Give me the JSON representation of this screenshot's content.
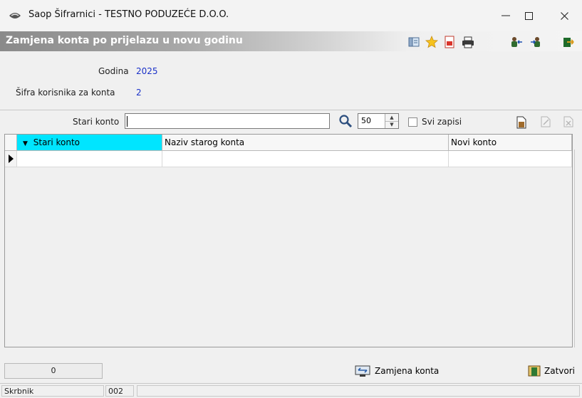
{
  "window": {
    "title": "Saop Šifrarnici - TESTNO PODUZEĆE D.O.O.",
    "app_icon": "eye-logo-icon",
    "controls": {
      "minimize": "—",
      "maximize": "☐",
      "close": "✕"
    }
  },
  "form": {
    "title": "Zamjena konta po prijelazu u novu godinu",
    "toolbar_icons": [
      "tree-view-icon",
      "star-icon",
      "pdf-icon",
      "printer-icon",
      "people-back-icon",
      "people-forward-icon",
      "exit-icon"
    ]
  },
  "info": {
    "godina_label": "Godina",
    "godina_value": "2025",
    "sifra_label": "Šifra korisnika za konta",
    "sifra_value": "2"
  },
  "filter": {
    "stari_konto_label": "Stari konto",
    "stari_konto_value": "",
    "count_value": "50",
    "svi_zapisi_label": "Svi zapisi",
    "svi_zapisi_checked": false
  },
  "grid": {
    "columns": [
      "Stari konto",
      "Naziv starog konta",
      "Novi konto"
    ],
    "sorted_column": "Stari konto",
    "rows": [
      {
        "stari": "",
        "naziv": "",
        "novi": ""
      }
    ]
  },
  "footer": {
    "record_count": "0",
    "zamjena_button": "Zamjena konta",
    "zatvori_button": "Zatvori"
  },
  "status": {
    "user": "Skrbnik",
    "code": "002"
  },
  "colors": {
    "accent_header": "#00e5ff",
    "value_blue": "#1a31c8",
    "window_bg": "#f0f0f0"
  }
}
